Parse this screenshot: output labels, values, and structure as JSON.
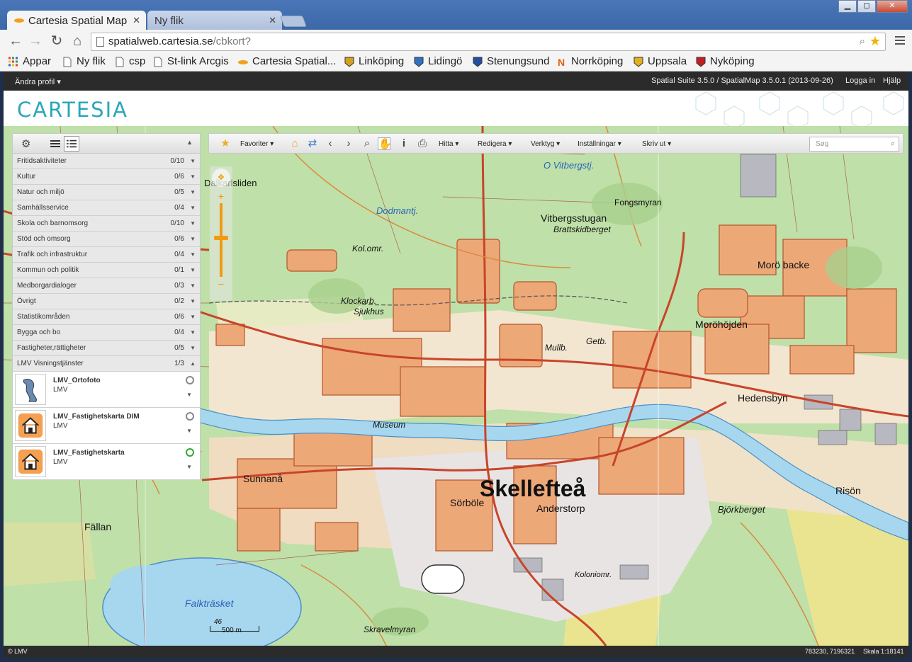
{
  "browser": {
    "tabs": [
      {
        "title": "Cartesia Spatial Map",
        "active": true
      },
      {
        "title": "Ny flik",
        "active": false
      }
    ],
    "url_host": "spatialweb.cartesia.se",
    "url_path": "/cbkort?",
    "bookmarks": [
      "Appar",
      "Ny flik",
      "csp",
      "St-link Arcgis",
      "Cartesia Spatial...",
      "Linköping",
      "Lidingö",
      "Stenungsund",
      "Norrköping",
      "Uppsala",
      "Nyköping"
    ]
  },
  "app": {
    "profile": "Ändra profil",
    "version": "Spatial Suite 3.5.0 / SpatialMap 3.5.0.1 (2013-09-26)",
    "login": "Logga in",
    "help": "Hjälp",
    "logo": "CARTESIA"
  },
  "panel": {
    "categories": [
      {
        "name": "Fritidsaktiviteter",
        "count": "0/10"
      },
      {
        "name": "Kultur",
        "count": "0/6"
      },
      {
        "name": "Natur och miljö",
        "count": "0/5"
      },
      {
        "name": "Samhällsservice",
        "count": "0/4"
      },
      {
        "name": "Skola och barnomsorg",
        "count": "0/10"
      },
      {
        "name": "Stöd och omsorg",
        "count": "0/6"
      },
      {
        "name": "Trafik och infrastruktur",
        "count": "0/4"
      },
      {
        "name": "Kommun och politik",
        "count": "0/1"
      },
      {
        "name": "Medborgardialoger",
        "count": "0/3"
      },
      {
        "name": "Övrigt",
        "count": "0/2"
      },
      {
        "name": "Statistikområden",
        "count": "0/6"
      },
      {
        "name": "Bygga och bo",
        "count": "0/4"
      },
      {
        "name": "Fastigheter,rättigheter",
        "count": "0/5"
      },
      {
        "name": "LMV Visningstjänster",
        "count": "1/3"
      }
    ],
    "layers": [
      {
        "name": "LMV_Ortofoto",
        "source": "LMV",
        "on": false
      },
      {
        "name": "LMV_Fastighetskarta DIM",
        "source": "LMV",
        "on": false
      },
      {
        "name": "LMV_Fastighetskarta",
        "source": "LMV",
        "on": true
      }
    ]
  },
  "maptoolbar": {
    "favorites": "Favoriter",
    "find": "Hitta",
    "edit": "Redigera",
    "tools": "Verktyg",
    "settings": "Inställningar",
    "print": "Skriv ut",
    "search_placeholder": "Søg"
  },
  "map": {
    "places": {
      "dalkarlsliden": "Dalkarlsliden",
      "vitbergstjarn": "O Vitbergstj.",
      "fongsmyran": "Fongsmyran",
      "vitbergsstugan": "Vitbergsstugan",
      "brattskidberget": "Brattskidberget",
      "moro_backe": "Morö backe",
      "dodmantj": "Dodmantj.",
      "kolomr": "Kol.omr.",
      "klockarb": "Klockarb.",
      "sjukhus": "Sjukhus",
      "morohojden": "Moröhöjden",
      "mullb": "Mullb.",
      "getb": "Getb.",
      "hedensbyn": "Hedensbyn",
      "museum": "Museum",
      "sunnana": "Sunnanå",
      "skelleftea": "Skellefteå",
      "sorbole": "Sörböle",
      "anderstorp": "Anderstorp",
      "rison": "Risön",
      "fallan": "Fällan",
      "falktrasket": "Falkträsket",
      "skravelmyran": "Skravelmyran",
      "bjorkberget": "Björkberget",
      "koloniomr": "Koloniomr."
    },
    "scale_label": "500 m",
    "scale_number": "46"
  },
  "status": {
    "copyright": "© LMV",
    "coordinates": "783230, 7196321",
    "scale": "Skala 1:18141"
  },
  "colors": {
    "accent": "#f29a10",
    "logo": "#2aa7b8",
    "bar": "#2b2b2b"
  }
}
